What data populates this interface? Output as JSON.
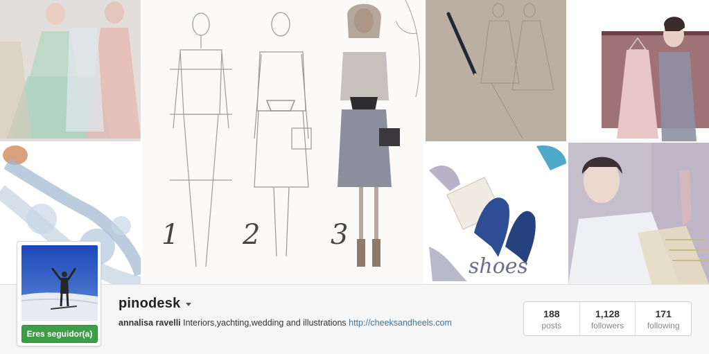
{
  "profile": {
    "username": "pinodesk",
    "full_name": "annalisa ravelli",
    "bio_text": "Interiors,yachting,wedding and illustrations",
    "website": "http://cheeksandheels.com",
    "follow_button_label": "Eres seguidor(a)"
  },
  "stats": [
    {
      "count": "188",
      "label": "posts"
    },
    {
      "count": "1,128",
      "label": "followers"
    },
    {
      "count": "171",
      "label": "following"
    }
  ],
  "mosaic": {
    "sketch_numbers": [
      "1",
      "2",
      "3"
    ],
    "shoes_caption": "shoes"
  },
  "colors": {
    "follow_green": "#3e9d47",
    "link_blue": "#3f729b"
  }
}
